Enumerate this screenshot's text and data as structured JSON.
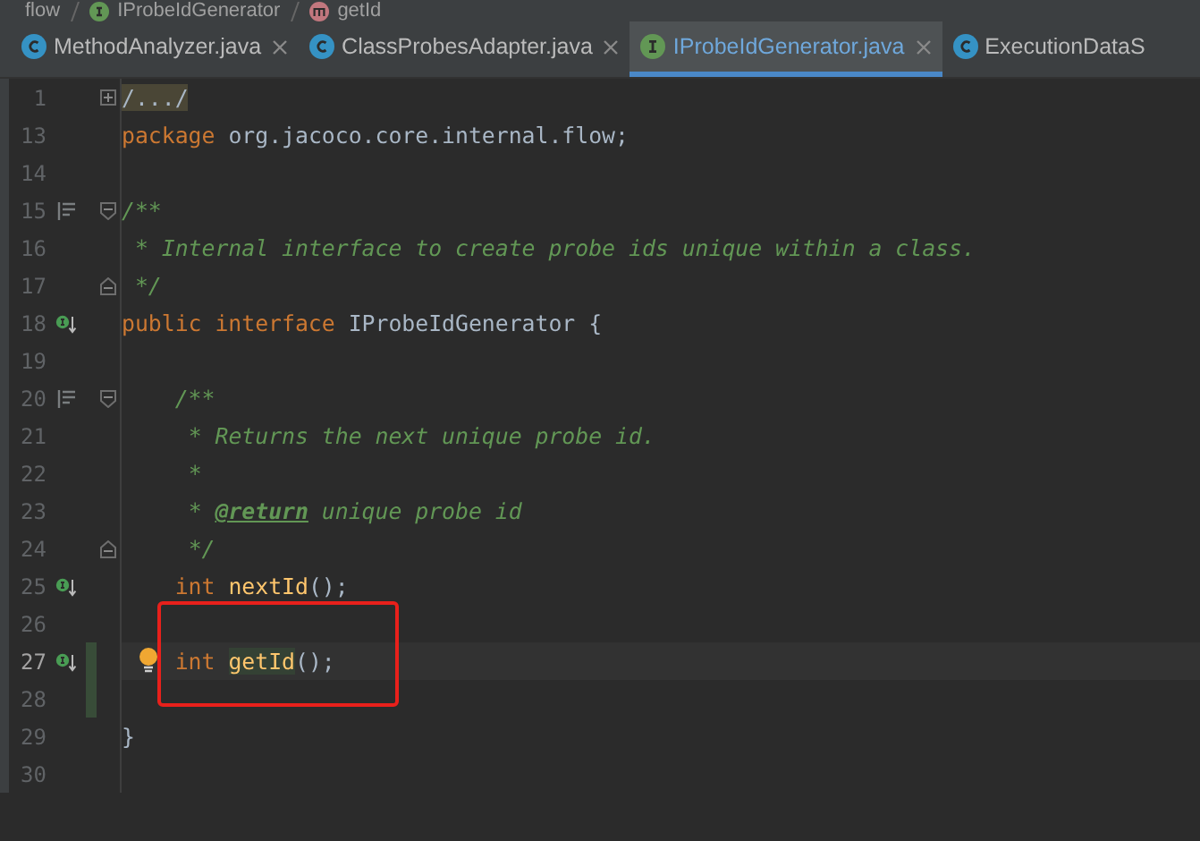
{
  "breadcrumbs": [
    {
      "label": "flow",
      "kind": "package"
    },
    {
      "label": "IProbeIdGenerator",
      "kind": "interface"
    },
    {
      "label": "getId",
      "kind": "method"
    }
  ],
  "tabs": [
    {
      "label": "MethodAnalyzer.java",
      "kind": "class",
      "selected": false
    },
    {
      "label": "ClassProbesAdapter.java",
      "kind": "class",
      "selected": false
    },
    {
      "label": "IProbeIdGenerator.java",
      "kind": "interface",
      "selected": true
    },
    {
      "label": "ExecutionDataS",
      "kind": "class",
      "selected": false
    }
  ],
  "lines": [
    {
      "number": "1",
      "kind": "folded",
      "changed": false,
      "segments": [
        {
          "kind": "folded",
          "text": "/.../"
        }
      ]
    },
    {
      "number": "13",
      "kind": "plain",
      "changed": false,
      "segments": [
        {
          "kind": "keyword",
          "text": "package "
        },
        {
          "kind": "plain",
          "text": "org.jacoco.core.internal.flow;"
        }
      ]
    },
    {
      "number": "14",
      "kind": "plain",
      "changed": false
    },
    {
      "number": "15",
      "kind": "doc-start",
      "changed": false,
      "segments": [
        {
          "kind": "comment",
          "text": "/**"
        }
      ]
    },
    {
      "number": "16",
      "kind": "plain",
      "changed": false,
      "segments": [
        {
          "kind": "comment",
          "text": " * Internal interface to create probe ids unique within a class."
        }
      ]
    },
    {
      "number": "17",
      "kind": "doc-end",
      "changed": false,
      "segments": [
        {
          "kind": "comment",
          "text": " */"
        }
      ]
    },
    {
      "number": "18",
      "kind": "implemented",
      "changed": false,
      "segments": [
        {
          "kind": "keyword",
          "text": "public interface "
        },
        {
          "kind": "plain",
          "text": "IProbeIdGenerator {"
        }
      ]
    },
    {
      "number": "19",
      "kind": "plain",
      "changed": false
    },
    {
      "number": "20",
      "kind": "doc-start",
      "changed": false,
      "segments": [
        {
          "kind": "comment",
          "text": "    /**"
        }
      ]
    },
    {
      "number": "21",
      "kind": "plain",
      "changed": false,
      "segments": [
        {
          "kind": "comment",
          "text": "     * Returns the next unique probe id."
        }
      ]
    },
    {
      "number": "22",
      "kind": "plain",
      "changed": false,
      "segments": [
        {
          "kind": "comment",
          "text": "     *"
        }
      ]
    },
    {
      "number": "23",
      "kind": "plain",
      "changed": false,
      "segments": [
        {
          "kind": "comment",
          "text": "     * "
        },
        {
          "kind": "doc-tag",
          "text": "@return"
        },
        {
          "kind": "comment",
          "text": " unique probe id"
        }
      ]
    },
    {
      "number": "24",
      "kind": "doc-end",
      "changed": false,
      "segments": [
        {
          "kind": "comment",
          "text": "     */"
        }
      ]
    },
    {
      "number": "25",
      "kind": "implemented",
      "changed": false,
      "segments": [
        {
          "kind": "keyword",
          "text": "    int "
        },
        {
          "kind": "method",
          "text": "nextId"
        },
        {
          "kind": "plain",
          "text": "();"
        }
      ]
    },
    {
      "number": "26",
      "kind": "plain",
      "changed": false
    },
    {
      "number": "27",
      "kind": "caret",
      "changed": true,
      "segments": [
        {
          "kind": "keyword",
          "text": "    int "
        },
        {
          "kind": "method-usage",
          "text": "getId"
        },
        {
          "kind": "plain",
          "text": "();"
        }
      ]
    },
    {
      "number": "28",
      "kind": "plain",
      "changed": true
    },
    {
      "number": "29",
      "kind": "plain",
      "changed": false,
      "segments": [
        {
          "kind": "plain",
          "text": "}"
        }
      ]
    },
    {
      "number": "30",
      "kind": "plain",
      "changed": false
    }
  ]
}
